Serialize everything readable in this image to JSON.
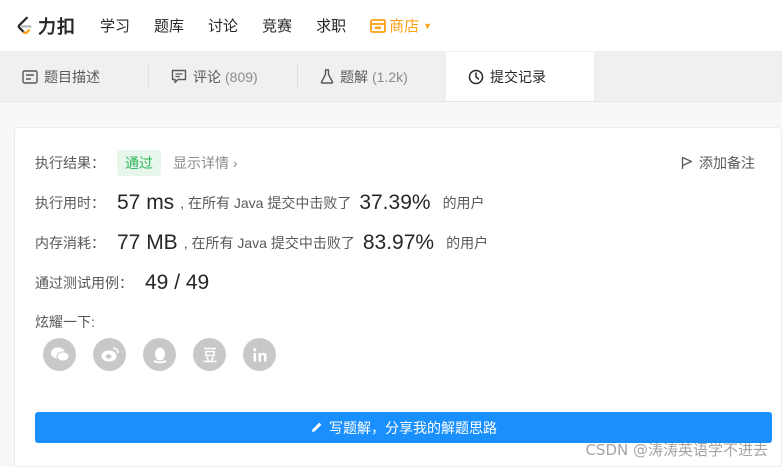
{
  "nav": {
    "brand_logo_icon": "leetcode-logo-icon",
    "brand_name": "力扣",
    "items": [
      "学习",
      "题库",
      "讨论",
      "竞赛",
      "求职"
    ],
    "shop_label": "商店",
    "shop_icon": "shop-icon",
    "shop_color": "#ffa116"
  },
  "tabs": [
    {
      "label": "题目描述",
      "count": "",
      "icon": "description-icon"
    },
    {
      "label": "评论",
      "count": "(809)",
      "icon": "comment-icon"
    },
    {
      "label": "题解",
      "count": "(1.2k)",
      "icon": "flask-icon"
    },
    {
      "label": "提交记录",
      "count": "",
      "icon": "clock-icon",
      "active": true
    }
  ],
  "result": {
    "label": "执行结果：",
    "status": "通过",
    "detail_link": "显示详情 ›",
    "add_note": "添加备注",
    "status_color": "#2db55d"
  },
  "runtime": {
    "label": "执行用时：",
    "value": "57 ms",
    "text": ", 在所有 Java 提交中击败了",
    "percent": "37.39%",
    "suffix": "的用户"
  },
  "memory": {
    "label": "内存消耗：",
    "value": "77 MB",
    "text": ", 在所有 Java 提交中击败了",
    "percent": "83.97%",
    "suffix": "的用户"
  },
  "testcases": {
    "label": "通过测试用例：",
    "value": "49 / 49"
  },
  "share": {
    "label": "炫耀一下:",
    "icons": [
      "wechat-icon",
      "weibo-icon",
      "qq-icon",
      "douban-icon",
      "linkedin-icon"
    ]
  },
  "write_button": {
    "label": "写题解，分享我的解题思路",
    "color": "#1a90ff"
  },
  "watermark": "CSDN @涛涛英语学不进去"
}
